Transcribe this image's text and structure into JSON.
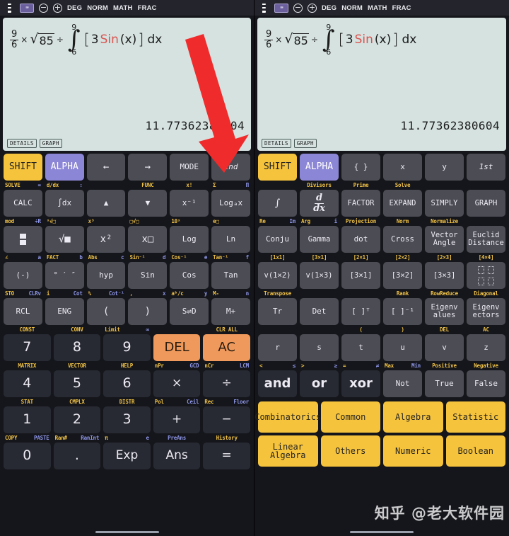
{
  "statusbar": {
    "menu_icon": "hamburger-menu-icon",
    "badge_icon": "keyboard-badge-icon",
    "zoom_out_icon": "minus-circle-icon",
    "zoom_in_icon": "plus-circle-icon",
    "modes": [
      "DEG",
      "NORM",
      "MATH",
      "FRAC"
    ]
  },
  "display": {
    "expression": {
      "frac_num": "9",
      "frac_den": "6",
      "times": "×",
      "sqrt_sym": "√",
      "sqrt_arg": "85",
      "divide": "÷",
      "int_upper": "9",
      "int_sym": "∫",
      "int_lower": "6",
      "bracket_open": "[",
      "coef": "3",
      "func": "Sin",
      "arg": "(x)",
      "bracket_close": "]",
      "dx": "dx"
    },
    "result": "11.77362380604",
    "result_left_clipped": "11.773623     604",
    "buttons": [
      "DETAILS",
      "GRAPH"
    ]
  },
  "colors": {
    "shift": "#f6c33c",
    "alpha": "#8c86d6",
    "orange": "#ef9a5c",
    "display_bg": "#d5e2e0",
    "key_bg": "#4c4c55",
    "numkey_bg": "#282a33",
    "sub_yellow": "#f0c246",
    "sub_blue": "#8e96e8",
    "arrow": "#f02b2b",
    "sin_red": "#d9534f"
  },
  "annotation": {
    "arrow_icon": "red-down-arrow-annotation",
    "points_to": "2nd"
  },
  "watermark": "知乎 @老大软件园",
  "left_keypad": {
    "rows": [
      {
        "subs": [],
        "keys": [
          {
            "label": "SHIFT",
            "style": "shift"
          },
          {
            "label": "ALPHA",
            "style": "alpha"
          },
          {
            "label": "←",
            "style": ""
          },
          {
            "label": "→",
            "style": ""
          },
          {
            "label": "MODE",
            "style": "small"
          },
          {
            "label": "2nd",
            "style": "ital small"
          }
        ]
      },
      {
        "subs": [
          {
            "l": "SOLVE",
            "lc": "y",
            "r": "=",
            "rc": "b"
          },
          {
            "l": "d/dx",
            "lc": "y",
            "r": ":",
            "rc": "b"
          },
          {
            "l": "",
            "lc": "y",
            "r": "",
            "rc": "b"
          },
          {
            "l": "FUNC",
            "lc": "y",
            "r": "",
            "rc": "b",
            "center": true
          },
          {
            "l": "x!",
            "lc": "y",
            "r": "",
            "rc": "b",
            "center": true
          },
          {
            "l": "Σ",
            "lc": "y",
            "r": "Π",
            "rc": "b"
          }
        ],
        "keys": [
          {
            "label": "CALC",
            "style": "small"
          },
          {
            "label": "∫dx",
            "style": "small"
          },
          {
            "label": "▲",
            "style": "small"
          },
          {
            "label": "▼",
            "style": "small"
          },
          {
            "label": "x⁻¹",
            "style": "small"
          },
          {
            "label": "Logₐx",
            "style": "small"
          }
        ]
      },
      {
        "subs": [
          {
            "l": "mod",
            "lc": "y",
            "r": "÷R",
            "rc": "b"
          },
          {
            "l": "ˣ√□",
            "lc": "y",
            "r": "",
            "rc": "b"
          },
          {
            "l": "x³",
            "lc": "y",
            "r": "",
            "rc": "b"
          },
          {
            "l": "□√□",
            "lc": "y",
            "r": "",
            "rc": "b"
          },
          {
            "l": "10ˣ",
            "lc": "y",
            "r": "",
            "rc": "b"
          },
          {
            "l": "e□",
            "lc": "y",
            "r": "",
            "rc": "b"
          }
        ],
        "keys": [
          {
            "label": "",
            "style": "",
            "icon": "fraction-icon"
          },
          {
            "label": "√■",
            "style": ""
          },
          {
            "label": "x²",
            "style": ""
          },
          {
            "label": "x□",
            "style": ""
          },
          {
            "label": "Log",
            "style": "small"
          },
          {
            "label": "Ln",
            "style": "small"
          }
        ]
      },
      {
        "subs": [
          {
            "l": "∠",
            "lc": "y",
            "r": "a",
            "rc": "b"
          },
          {
            "l": "FACT",
            "lc": "y",
            "r": "b",
            "rc": "b"
          },
          {
            "l": "Abs",
            "lc": "y",
            "r": "c",
            "rc": "b"
          },
          {
            "l": "Sin⁻¹",
            "lc": "y",
            "r": "d",
            "rc": "b"
          },
          {
            "l": "Cos⁻¹",
            "lc": "y",
            "r": "e",
            "rc": "b"
          },
          {
            "l": "Tan⁻¹",
            "lc": "y",
            "r": "f",
            "rc": "b"
          }
        ],
        "keys": [
          {
            "label": "(-)",
            "style": "small"
          },
          {
            "label": "° ′ ″",
            "style": "xs"
          },
          {
            "label": "hyp",
            "style": "small"
          },
          {
            "label": "Sin",
            "style": "small"
          },
          {
            "label": "Cos",
            "style": "small"
          },
          {
            "label": "Tan",
            "style": "small"
          }
        ]
      },
      {
        "subs": [
          {
            "l": "STO",
            "lc": "y",
            "r": "CLRv",
            "rc": "b"
          },
          {
            "l": "i",
            "lc": "y",
            "r": "Cot",
            "rc": "b"
          },
          {
            "l": "%",
            "lc": "y",
            "r": "Cot⁻¹",
            "rc": "b"
          },
          {
            "l": ",",
            "lc": "y",
            "r": "x",
            "rc": "b"
          },
          {
            "l": "aᵇ/c",
            "lc": "y",
            "r": "y",
            "rc": "b"
          },
          {
            "l": "M-",
            "lc": "y",
            "r": "n",
            "rc": "b"
          }
        ],
        "keys": [
          {
            "label": "RCL",
            "style": "small"
          },
          {
            "label": "ENG",
            "style": "small"
          },
          {
            "label": "(",
            "style": ""
          },
          {
            "label": ")",
            "style": ""
          },
          {
            "label": "S⇌D",
            "style": "small"
          },
          {
            "label": "M+",
            "style": "small"
          }
        ]
      }
    ],
    "numpad": [
      {
        "subs": [
          {
            "l": "CONST",
            "lc": "y",
            "center": true
          },
          {
            "l": "CONV",
            "lc": "y",
            "center": true
          },
          {
            "l": "Limit",
            "lc": "y",
            "r": "∞",
            "rc": "b"
          },
          {
            "l": "",
            "lc": "y"
          },
          {
            "l": "CLR ALL",
            "lc": "y",
            "center": true
          }
        ],
        "keys": [
          {
            "label": "7",
            "style": "num"
          },
          {
            "label": "8",
            "style": "num"
          },
          {
            "label": "9",
            "style": "num"
          },
          {
            "label": "DEL",
            "style": "orange"
          },
          {
            "label": "AC",
            "style": "orange"
          }
        ]
      },
      {
        "subs": [
          {
            "l": "MATRIX",
            "lc": "y",
            "center": true
          },
          {
            "l": "VECTOR",
            "lc": "y",
            "center": true
          },
          {
            "l": "HELP",
            "lc": "y",
            "center": true
          },
          {
            "l": "nPr",
            "lc": "y",
            "r": "GCD",
            "rc": "b"
          },
          {
            "l": "nCr",
            "lc": "y",
            "r": "LCM",
            "rc": "b"
          }
        ],
        "keys": [
          {
            "label": "4",
            "style": "num"
          },
          {
            "label": "5",
            "style": "num"
          },
          {
            "label": "6",
            "style": "num"
          },
          {
            "label": "×",
            "style": "num op"
          },
          {
            "label": "÷",
            "style": "num op"
          }
        ]
      },
      {
        "subs": [
          {
            "l": "STAT",
            "lc": "y",
            "center": true
          },
          {
            "l": "CMPLX",
            "lc": "y",
            "center": true
          },
          {
            "l": "DISTR",
            "lc": "y",
            "center": true
          },
          {
            "l": "Pol",
            "lc": "y",
            "r": "Ceil",
            "rc": "b"
          },
          {
            "l": "Rec",
            "lc": "y",
            "r": "Floor",
            "rc": "b"
          }
        ],
        "keys": [
          {
            "label": "1",
            "style": "num"
          },
          {
            "label": "2",
            "style": "num"
          },
          {
            "label": "3",
            "style": "num"
          },
          {
            "label": "+",
            "style": "num op"
          },
          {
            "label": "−",
            "style": "num op"
          }
        ]
      },
      {
        "subs": [
          {
            "l": "COPY",
            "lc": "y",
            "r": "PASTE",
            "rc": "b"
          },
          {
            "l": "Ran#",
            "lc": "y",
            "r": "RanInt",
            "rc": "b"
          },
          {
            "l": "π",
            "lc": "y",
            "r": "e",
            "rc": "b"
          },
          {
            "l": "PreAns",
            "lc": "b",
            "center": true
          },
          {
            "l": "History",
            "lc": "y",
            "center": true
          }
        ],
        "keys": [
          {
            "label": "0",
            "style": "num"
          },
          {
            "label": ".",
            "style": "num"
          },
          {
            "label": "Exp",
            "style": "num op"
          },
          {
            "label": "Ans",
            "style": "num op"
          },
          {
            "label": "=",
            "style": "num op"
          }
        ]
      }
    ]
  },
  "right_keypad": {
    "rows": [
      {
        "subs": [],
        "keys": [
          {
            "label": "SHIFT",
            "style": "shift"
          },
          {
            "label": "ALPHA",
            "style": "alpha"
          },
          {
            "label": "{ }",
            "style": "small"
          },
          {
            "label": "x",
            "style": "small"
          },
          {
            "label": "y",
            "style": "small"
          },
          {
            "label": "1st",
            "style": "ital small"
          }
        ]
      },
      {
        "subs": [
          {
            "l": "",
            "lc": "y",
            "center": true
          },
          {
            "l": "Divisors",
            "lc": "y",
            "center": true
          },
          {
            "l": "Prime",
            "lc": "y",
            "center": true
          },
          {
            "l": "Solve",
            "lc": "y",
            "center": true
          },
          {
            "l": "",
            "lc": "y",
            "center": true
          },
          {
            "l": "",
            "lc": "y",
            "center": true
          }
        ],
        "keys": [
          {
            "label": "∫",
            "style": "serif"
          },
          {
            "label": "",
            "style": "",
            "icon": "ddx-icon"
          },
          {
            "label": "FACTOR",
            "style": "xs"
          },
          {
            "label": "EXPAND",
            "style": "xs"
          },
          {
            "label": "SIMPLY",
            "style": "xs"
          },
          {
            "label": "GRAPH",
            "style": "xs"
          }
        ]
      },
      {
        "subs": [
          {
            "l": "Re",
            "lc": "y",
            "r": "Im",
            "rc": "b"
          },
          {
            "l": "Arg",
            "lc": "y",
            "r": "i",
            "rc": "b"
          },
          {
            "l": "Projection",
            "lc": "y",
            "center": true
          },
          {
            "l": "Norm",
            "lc": "y",
            "center": true
          },
          {
            "l": "Normalize",
            "lc": "y",
            "center": true
          },
          {
            "l": "",
            "lc": "y",
            "center": true
          }
        ],
        "keys": [
          {
            "label": "Conju",
            "style": "small"
          },
          {
            "label": "Gamma",
            "style": "xs"
          },
          {
            "label": "dot",
            "style": "small"
          },
          {
            "label": "Cross",
            "style": "small"
          },
          {
            "label": "Vector\nAngle",
            "style": "xs"
          },
          {
            "label": "Euclid\nDistance",
            "style": "xs"
          }
        ]
      },
      {
        "subs": [
          {
            "l": "[1x1]",
            "lc": "y",
            "center": true
          },
          {
            "l": "[3×1]",
            "lc": "y",
            "center": true
          },
          {
            "l": "[2×1]",
            "lc": "y",
            "center": true
          },
          {
            "l": "[2×2]",
            "lc": "y",
            "center": true
          },
          {
            "l": "[2×3]",
            "lc": "y",
            "center": true
          },
          {
            "l": "[4×4]",
            "lc": "y",
            "center": true
          }
        ],
        "keys": [
          {
            "label": "v(1×2)",
            "style": "xs"
          },
          {
            "label": "v(1×3)",
            "style": "xs"
          },
          {
            "label": "[3×1]",
            "style": "xs"
          },
          {
            "label": "[3×2]",
            "style": "xs"
          },
          {
            "label": "[3×3]",
            "style": "xs"
          },
          {
            "label": "",
            "style": "",
            "icon": "diagonal-matrix-icon"
          }
        ]
      },
      {
        "subs": [
          {
            "l": "Transpose",
            "lc": "y",
            "center": true
          },
          {
            "l": "",
            "lc": "y",
            "center": true
          },
          {
            "l": "",
            "lc": "y",
            "center": true
          },
          {
            "l": "Rank",
            "lc": "y",
            "center": true
          },
          {
            "l": "RowReduce",
            "lc": "y",
            "center": true
          },
          {
            "l": "Diagonal",
            "lc": "y",
            "center": true
          }
        ],
        "keys": [
          {
            "label": "Tr",
            "style": "small"
          },
          {
            "label": "Det",
            "style": "small"
          },
          {
            "label": "[ ]ᵀ",
            "style": "small"
          },
          {
            "label": "[ ]⁻¹",
            "style": "small"
          },
          {
            "label": "Eigenv\nalues",
            "style": "xs"
          },
          {
            "label": "Eigenv\nectors",
            "style": "xs"
          }
        ]
      },
      {
        "subs": [
          {
            "l": "",
            "lc": "y",
            "center": true
          },
          {
            "l": "",
            "lc": "y",
            "center": true
          },
          {
            "l": "(",
            "lc": "y",
            "center": true
          },
          {
            "l": ")",
            "lc": "y",
            "center": true
          },
          {
            "l": "DEL",
            "lc": "y",
            "center": true
          },
          {
            "l": "AC",
            "lc": "y",
            "center": true
          }
        ],
        "keys": [
          {
            "label": "r",
            "style": "small"
          },
          {
            "label": "s",
            "style": "small"
          },
          {
            "label": "t",
            "style": "small"
          },
          {
            "label": "u",
            "style": "small"
          },
          {
            "label": "v",
            "style": "small"
          },
          {
            "label": "z",
            "style": "small"
          }
        ]
      },
      {
        "subs": [
          {
            "l": "<",
            "lc": "y",
            "r": "≤",
            "rc": "b"
          },
          {
            "l": ">",
            "lc": "y",
            "r": "≥",
            "rc": "b"
          },
          {
            "l": "=",
            "lc": "y",
            "r": "≠",
            "rc": "b"
          },
          {
            "l": "Max",
            "lc": "y",
            "r": "Min",
            "rc": "b"
          },
          {
            "l": "Positive",
            "lc": "y",
            "center": true
          },
          {
            "l": "Negative",
            "lc": "y",
            "center": true
          }
        ],
        "keys": [
          {
            "label": "and",
            "style": "dark"
          },
          {
            "label": "or",
            "style": "dark"
          },
          {
            "label": "xor",
            "style": "dark"
          },
          {
            "label": "Not",
            "style": "small"
          },
          {
            "label": "True",
            "style": "small"
          },
          {
            "label": "False",
            "style": "small"
          }
        ]
      }
    ],
    "category_rows": [
      [
        {
          "label": "Combinatorics"
        },
        {
          "label": "Common"
        },
        {
          "label": "Algebra"
        },
        {
          "label": "Statistic"
        }
      ],
      [
        {
          "label": "Linear Algebra"
        },
        {
          "label": "Others"
        },
        {
          "label": "Numeric"
        },
        {
          "label": "Boolean"
        }
      ]
    ]
  }
}
